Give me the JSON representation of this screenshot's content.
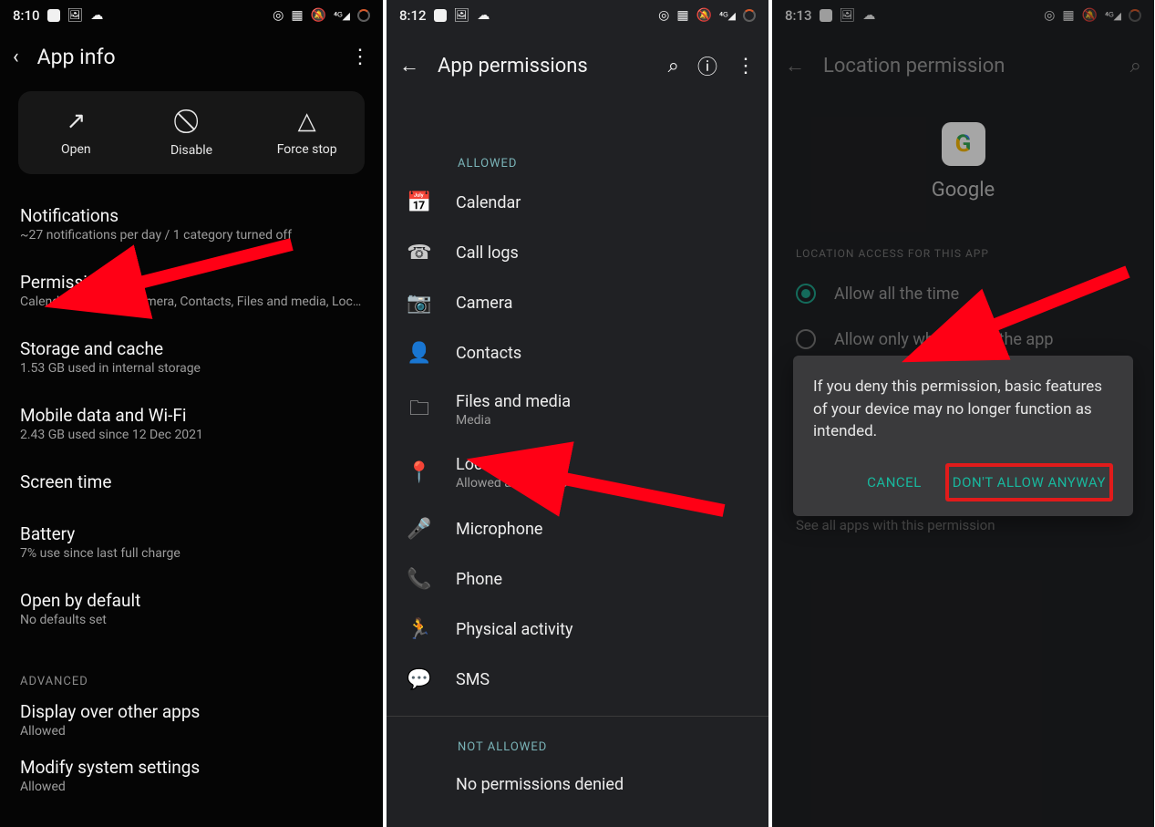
{
  "phoneA": {
    "time": "8:10",
    "title": "App info",
    "actions": {
      "open": "Open",
      "disable": "Disable",
      "forcestop": "Force stop"
    },
    "rows": {
      "notifications": {
        "t": "Notifications",
        "s": "~27 notifications per day / 1 category turned off"
      },
      "permissions": {
        "t": "Permissions",
        "s": "Calendar, Call logs, Camera, Contacts, Files and media, Loca…"
      },
      "storage": {
        "t": "Storage and cache",
        "s": "1.53 GB used in internal storage"
      },
      "data": {
        "t": "Mobile data and Wi-Fi",
        "s": "2.43 GB used since 12 Dec 2021"
      },
      "screentime": {
        "t": "Screen time",
        "s": ""
      },
      "battery": {
        "t": "Battery",
        "s": "7% use since last full charge"
      },
      "openbydefault": {
        "t": "Open by default",
        "s": "No defaults set"
      },
      "advanced_label": "ADVANCED",
      "displayover": {
        "t": "Display over other apps",
        "s": "Allowed"
      },
      "modifysys": {
        "t": "Modify system settings",
        "s": "Allowed"
      }
    }
  },
  "phoneB": {
    "time": "8:12",
    "title": "App permissions",
    "allowed_label": "ALLOWED",
    "notallowed_label": "NOT ALLOWED",
    "items": {
      "calendar": {
        "t": "Calendar"
      },
      "calllogs": {
        "t": "Call logs"
      },
      "camera": {
        "t": "Camera"
      },
      "contacts": {
        "t": "Contacts"
      },
      "files": {
        "t": "Files and media",
        "s": "Media"
      },
      "location": {
        "t": "Location",
        "s": "Allowed all the time"
      },
      "microphone": {
        "t": "Microphone"
      },
      "phone": {
        "t": "Phone"
      },
      "activity": {
        "t": "Physical activity"
      },
      "sms": {
        "t": "SMS"
      }
    },
    "none_denied": "No permissions denied"
  },
  "phoneC": {
    "time": "8:13",
    "title": "Location permission",
    "app_name": "Google",
    "section": "LOCATION ACCESS FOR THIS APP",
    "opts": {
      "all": "Allow all the time",
      "while": "Allow only while using the app"
    },
    "see_all": "See all apps with this permission",
    "dialog": {
      "msg": "If you deny this permission, basic features of your device may no longer function as intended.",
      "cancel": "CANCEL",
      "deny": "DON'T ALLOW ANYWAY"
    }
  }
}
